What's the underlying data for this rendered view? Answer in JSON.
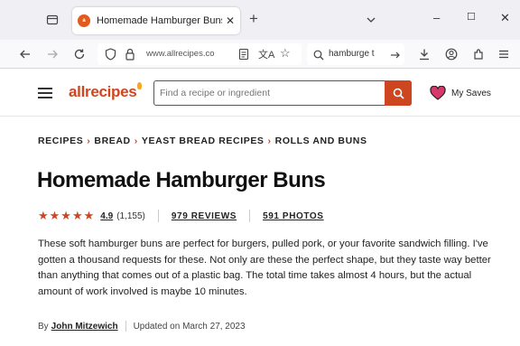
{
  "browser": {
    "tab": {
      "title": "Homemade Hamburger Buns R",
      "favicon_text": "a"
    },
    "new_tab_label": "+",
    "window_controls": {
      "minimize": "–",
      "maximize": "☐",
      "close": "✕"
    },
    "address_bar": {
      "url": "www.allrecipes.co"
    },
    "search_bar": {
      "value": "hamburge t"
    },
    "icons": [
      "tab-list-icon",
      "back-icon",
      "forward-icon",
      "reload-icon",
      "shield-icon",
      "lock-icon",
      "reader-mode-icon",
      "translate-icon",
      "bookmark-star-icon",
      "search-icon",
      "arrow-right-icon",
      "download-icon",
      "account-icon",
      "extensions-icon",
      "menu-icon"
    ]
  },
  "site": {
    "logo": "allrecipes",
    "search_placeholder": "Find a recipe or ingredient",
    "saves_label": "My Saves",
    "accent": "#ce4620"
  },
  "breadcrumb": [
    "RECIPES",
    "BREAD",
    "YEAST BREAD RECIPES",
    "ROLLS AND BUNS"
  ],
  "breadcrumb_sep": "›",
  "recipe": {
    "title": "Homemade Hamburger Buns",
    "stars": "★★★★★",
    "rating_stars": 4.9,
    "rating": "4.9",
    "rating_count": "(1,155)",
    "reviews": "979 REVIEWS",
    "photos": "591 PHOTOS",
    "intro": "These soft hamburger buns are perfect for burgers, pulled pork, or your favorite sandwich filling. I've gotten a thousand requests for these. Not only are these the perfect shape, but they taste way better than anything that comes out of a plastic bag. The total time takes almost 4 hours, but the actual amount of work involved is maybe 10 minutes.",
    "byline_prefix": "By",
    "author": "John Mitzewich",
    "updated": "Updated on March 27, 2023"
  }
}
